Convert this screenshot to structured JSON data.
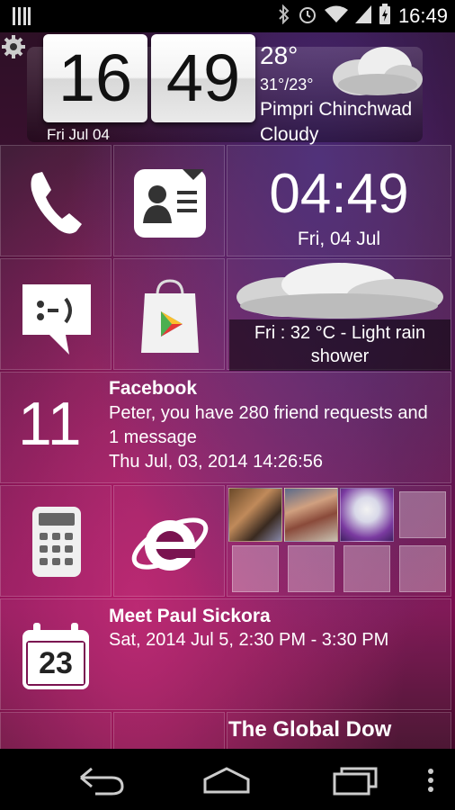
{
  "status_bar": {
    "time": "16:49",
    "icons": [
      "bars-icon",
      "bluetooth-icon",
      "alarm-icon",
      "wifi-icon",
      "signal-icon",
      "battery-charging-icon"
    ]
  },
  "clock_widget": {
    "hours": "16",
    "minutes": "49",
    "date": "Fri  Jul 04"
  },
  "weather_widget": {
    "temp": "28°",
    "range": "31°/23°",
    "city": "Pimpri Chinchwad",
    "condition": "Cloudy"
  },
  "digital_clock_tile": {
    "time": "04:49",
    "date": "Fri, 04 Jul"
  },
  "forecast_tile": {
    "caption": "Fri : 32 °C - Light rain shower"
  },
  "facebook_tile": {
    "count": "11",
    "title": "Facebook",
    "message": "Peter, you have 280 friend requests and 1 message",
    "timestamp": "Thu Jul, 03, 2014 14:26:56"
  },
  "calendar_tile": {
    "day_number": "23",
    "title": "Meet Paul Sickora",
    "details": "Sat, 2014 Jul 5, 2:30 PM - 3:30 PM"
  },
  "news_tile": {
    "title": "The Global Dow"
  },
  "colors": {
    "accent": "#8a1058",
    "tile_border": "#ffffff"
  }
}
